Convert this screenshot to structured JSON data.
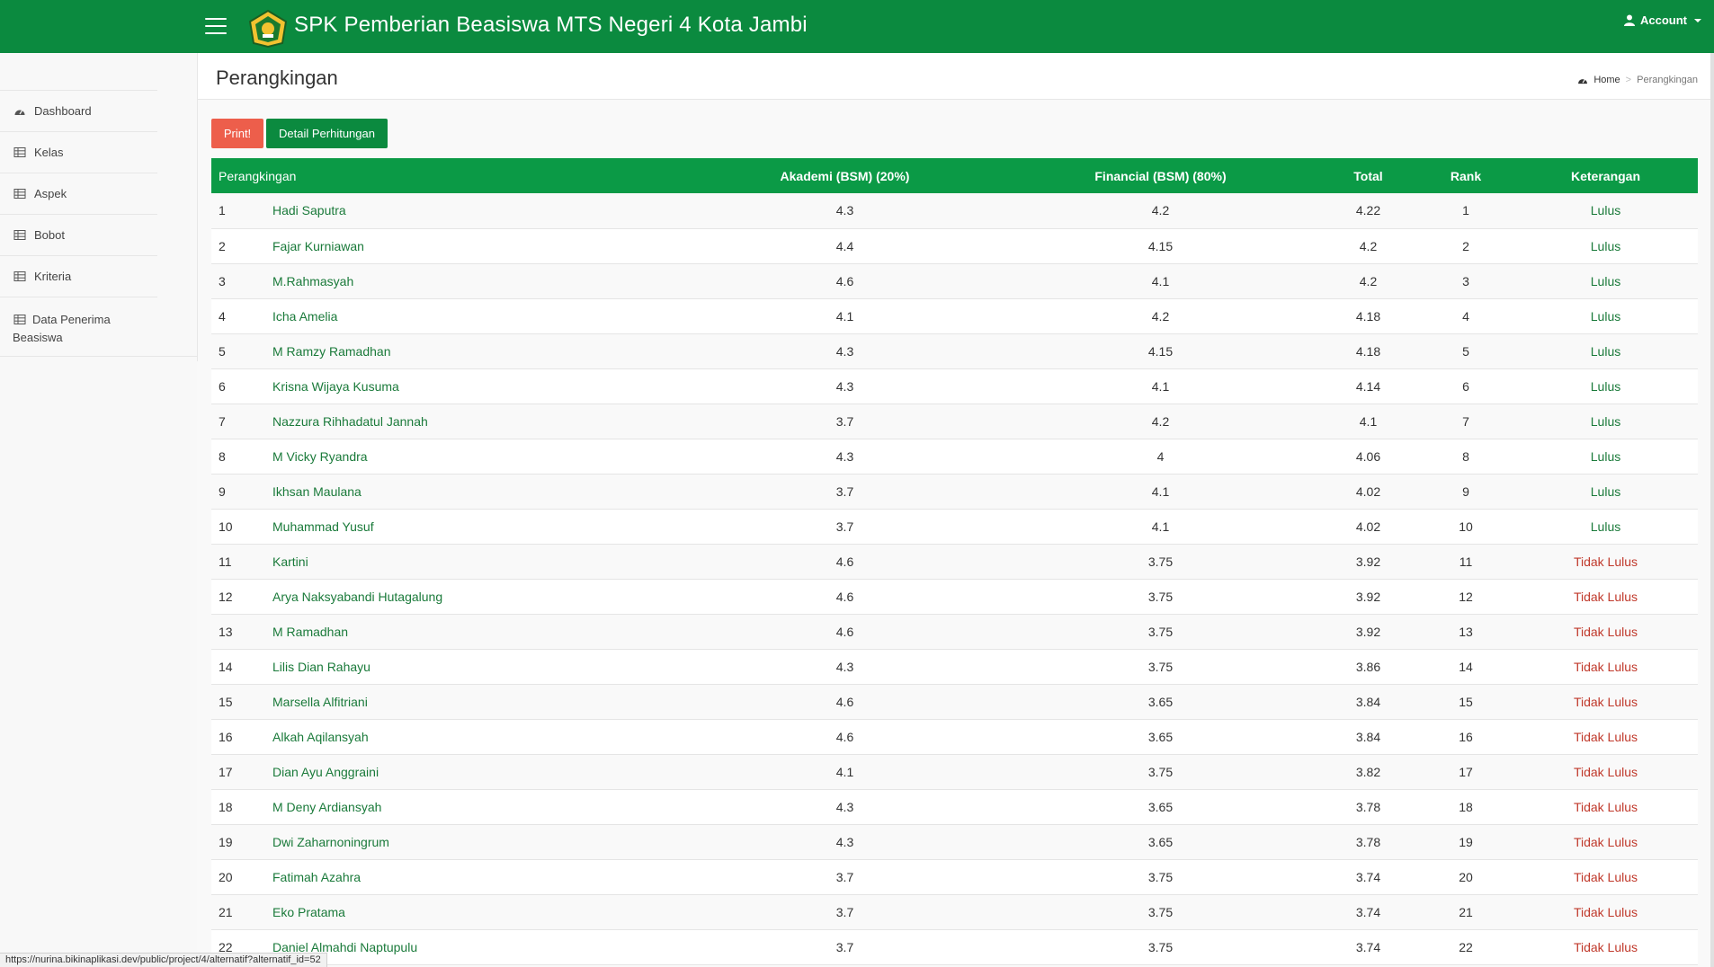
{
  "header": {
    "brand": "SPK Pemberian Beasiswa MTS Negeri 4 Kota Jambi",
    "account_label": "Account"
  },
  "sidebar": {
    "items": [
      {
        "label": "Dashboard",
        "icon": "dashboard-icon"
      },
      {
        "label": "Kelas",
        "icon": "table-icon"
      },
      {
        "label": "Aspek",
        "icon": "table-icon"
      },
      {
        "label": "Bobot",
        "icon": "table-icon"
      },
      {
        "label": "Kriteria",
        "icon": "table-icon"
      },
      {
        "label": "Data Penerima Beasiswa",
        "icon": "table-icon"
      }
    ]
  },
  "page": {
    "title": "Perangkingan",
    "breadcrumb": {
      "home": "Home",
      "current": "Perangkingan"
    }
  },
  "actions": {
    "print_label": "Print!",
    "detail_label": "Detail Perhitungan"
  },
  "table": {
    "headers": [
      "Perangkingan",
      "Akademi (BSM) (20%)",
      "Financial (BSM) (80%)",
      "Total",
      "Rank",
      "Keterangan"
    ],
    "rows": [
      {
        "no": "1",
        "name": "Hadi Saputra",
        "akademi": "4.3",
        "financial": "4.2",
        "total": "4.22",
        "rank": "1",
        "keterangan": "Lulus"
      },
      {
        "no": "2",
        "name": "Fajar Kurniawan",
        "akademi": "4.4",
        "financial": "4.15",
        "total": "4.2",
        "rank": "2",
        "keterangan": "Lulus"
      },
      {
        "no": "3",
        "name": "M.Rahmasyah",
        "akademi": "4.6",
        "financial": "4.1",
        "total": "4.2",
        "rank": "3",
        "keterangan": "Lulus"
      },
      {
        "no": "4",
        "name": "Icha Amelia",
        "akademi": "4.1",
        "financial": "4.2",
        "total": "4.18",
        "rank": "4",
        "keterangan": "Lulus"
      },
      {
        "no": "5",
        "name": "M Ramzy Ramadhan",
        "akademi": "4.3",
        "financial": "4.15",
        "total": "4.18",
        "rank": "5",
        "keterangan": "Lulus"
      },
      {
        "no": "6",
        "name": "Krisna Wijaya Kusuma",
        "akademi": "4.3",
        "financial": "4.1",
        "total": "4.14",
        "rank": "6",
        "keterangan": "Lulus"
      },
      {
        "no": "7",
        "name": "Nazzura Rihhadatul Jannah",
        "akademi": "3.7",
        "financial": "4.2",
        "total": "4.1",
        "rank": "7",
        "keterangan": "Lulus"
      },
      {
        "no": "8",
        "name": "M Vicky Ryandra",
        "akademi": "4.3",
        "financial": "4",
        "total": "4.06",
        "rank": "8",
        "keterangan": "Lulus"
      },
      {
        "no": "9",
        "name": "Ikhsan Maulana",
        "akademi": "3.7",
        "financial": "4.1",
        "total": "4.02",
        "rank": "9",
        "keterangan": "Lulus"
      },
      {
        "no": "10",
        "name": "Muhammad Yusuf",
        "akademi": "3.7",
        "financial": "4.1",
        "total": "4.02",
        "rank": "10",
        "keterangan": "Lulus"
      },
      {
        "no": "11",
        "name": "Kartini",
        "akademi": "4.6",
        "financial": "3.75",
        "total": "3.92",
        "rank": "11",
        "keterangan": "Tidak Lulus"
      },
      {
        "no": "12",
        "name": "Arya Naksyabandi Hutagalung",
        "akademi": "4.6",
        "financial": "3.75",
        "total": "3.92",
        "rank": "12",
        "keterangan": "Tidak Lulus"
      },
      {
        "no": "13",
        "name": "M Ramadhan",
        "akademi": "4.6",
        "financial": "3.75",
        "total": "3.92",
        "rank": "13",
        "keterangan": "Tidak Lulus"
      },
      {
        "no": "14",
        "name": "Lilis Dian Rahayu",
        "akademi": "4.3",
        "financial": "3.75",
        "total": "3.86",
        "rank": "14",
        "keterangan": "Tidak Lulus"
      },
      {
        "no": "15",
        "name": "Marsella Alfitriani",
        "akademi": "4.6",
        "financial": "3.65",
        "total": "3.84",
        "rank": "15",
        "keterangan": "Tidak Lulus"
      },
      {
        "no": "16",
        "name": "Alkah Aqilansyah",
        "akademi": "4.6",
        "financial": "3.65",
        "total": "3.84",
        "rank": "16",
        "keterangan": "Tidak Lulus"
      },
      {
        "no": "17",
        "name": "Dian Ayu Anggraini",
        "akademi": "4.1",
        "financial": "3.75",
        "total": "3.82",
        "rank": "17",
        "keterangan": "Tidak Lulus"
      },
      {
        "no": "18",
        "name": "M Deny Ardiansyah",
        "akademi": "4.3",
        "financial": "3.65",
        "total": "3.78",
        "rank": "18",
        "keterangan": "Tidak Lulus"
      },
      {
        "no": "19",
        "name": "Dwi Zaharnoningrum",
        "akademi": "4.3",
        "financial": "3.65",
        "total": "3.78",
        "rank": "19",
        "keterangan": "Tidak Lulus"
      },
      {
        "no": "20",
        "name": "Fatimah Azahra",
        "akademi": "3.7",
        "financial": "3.75",
        "total": "3.74",
        "rank": "20",
        "keterangan": "Tidak Lulus"
      },
      {
        "no": "21",
        "name": "Eko Pratama",
        "akademi": "3.7",
        "financial": "3.75",
        "total": "3.74",
        "rank": "21",
        "keterangan": "Tidak Lulus"
      },
      {
        "no": "22",
        "name": "Daniel Almahdi Naptupulu",
        "akademi": "3.7",
        "financial": "3.75",
        "total": "3.74",
        "rank": "22",
        "keterangan": "Tidak Lulus"
      }
    ]
  },
  "statusbar": {
    "url": "https://nurina.bikinaplikasi.dev/public/project/4/alternatif?alternatif_id=52"
  },
  "colors": {
    "brand_green": "#0b8a3f",
    "print_red": "#ed5e4b",
    "lulus": "#1a7a3a",
    "tidak_lulus": "#c0392b"
  }
}
